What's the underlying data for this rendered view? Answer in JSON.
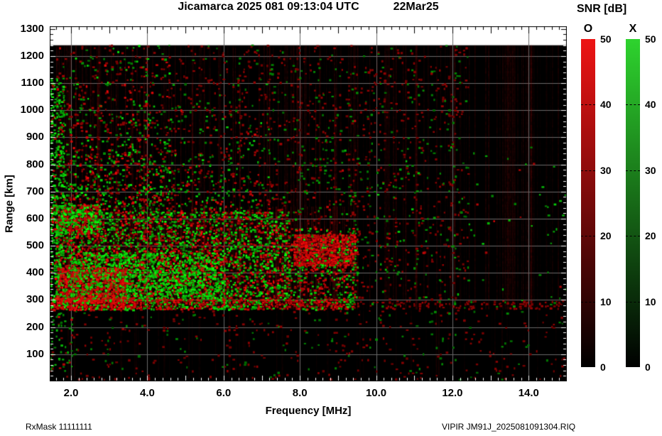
{
  "title": {
    "main": "Jicamarca 2025 081 09:13:04 UTC",
    "date": "22Mar25"
  },
  "footer": {
    "left": "RxMask 11111111",
    "right": "VIPIR  JM91J_2025081091304.RIQ"
  },
  "colorbar": {
    "title": "SNR [dB]",
    "min": 0,
    "max": 50,
    "ticks": [
      50,
      40,
      30,
      20,
      10,
      0
    ],
    "dashed_levels": [
      40,
      30,
      20,
      10
    ],
    "bars": [
      {
        "label": "O",
        "name": "o-mode",
        "color_top": "#ee1414"
      },
      {
        "label": "X",
        "name": "x-mode",
        "color_top": "#2ed32e"
      }
    ]
  },
  "chart_data": {
    "type": "heatmap",
    "title": "Jicamarca 2025 081 09:13:04 UTC 22Mar25",
    "xlabel": "Frequency [MHz]",
    "ylabel": "Range [km]",
    "xlim": [
      1.44,
      15.0
    ],
    "ylim": [
      0,
      1310
    ],
    "data_top_km": 1240,
    "grid": true,
    "grid_color": "#6a6a6a",
    "x_ticks": [
      {
        "value": 2,
        "label": "2.0"
      },
      {
        "value": 4,
        "label": "4.0"
      },
      {
        "value": 6,
        "label": "6.0"
      },
      {
        "value": 8,
        "label": "8.0"
      },
      {
        "value": 10,
        "label": "10.0"
      },
      {
        "value": 12,
        "label": "12.0"
      },
      {
        "value": 14,
        "label": "14.0"
      }
    ],
    "y_ticks": [
      {
        "value": 100,
        "label": "100"
      },
      {
        "value": 200,
        "label": "200"
      },
      {
        "value": 300,
        "label": "300"
      },
      {
        "value": 400,
        "label": "400"
      },
      {
        "value": 500,
        "label": "500"
      },
      {
        "value": 600,
        "label": "600"
      },
      {
        "value": 700,
        "label": "700"
      },
      {
        "value": 800,
        "label": "800"
      },
      {
        "value": 900,
        "label": "900"
      },
      {
        "value": 1000,
        "label": "1000"
      },
      {
        "value": 1100,
        "label": "1100"
      },
      {
        "value": 1200,
        "label": "1200"
      },
      {
        "value": 1300,
        "label": "1300"
      }
    ],
    "minor_tick_step_mhz": 0.2,
    "major_tick_step_mhz": 1.0,
    "minor_tick_step_km": 20,
    "major_tick_step_km": 100,
    "colorbars": [
      {
        "label": "O",
        "meaning": "O-mode SNR [dB]",
        "range": [
          0,
          50
        ]
      },
      {
        "label": "X",
        "meaning": "X-mode SNR [dB]",
        "range": [
          0,
          50
        ]
      }
    ],
    "seed": 1337,
    "echo_regions": [
      {
        "name": "below-band-noise",
        "f": [
          1.44,
          15.0
        ],
        "r": [
          5,
          262
        ],
        "density": 0.05,
        "green": 0.3,
        "bright": [
          0.05,
          0.3
        ],
        "cell": 3
      },
      {
        "name": "bottom-left-green",
        "f": [
          1.44,
          2.05
        ],
        "r": [
          40,
          262
        ],
        "density": 0.14,
        "green": 0.85,
        "bright": [
          0.15,
          0.65
        ],
        "cell": 3
      },
      {
        "name": "faint-wide-noise",
        "f": [
          1.6,
          12.4
        ],
        "r": [
          300,
          1240
        ],
        "density": 0.09,
        "green": 0.3,
        "bright": [
          0.08,
          0.35
        ],
        "cell": 3
      },
      {
        "name": "upper-spread-left",
        "f": [
          1.7,
          4.6
        ],
        "r": [
          620,
          1245
        ],
        "density": 0.34,
        "green": 0.55,
        "bright": [
          0.2,
          0.9
        ],
        "cell": 3,
        "fade_top": true
      },
      {
        "name": "upper-spread-mid",
        "f": [
          4.6,
          7.2
        ],
        "r": [
          620,
          1120
        ],
        "density": 0.16,
        "green": 0.5,
        "bright": [
          0.15,
          0.8
        ],
        "cell": 3,
        "fade_top": true
      },
      {
        "name": "upper-spread-right",
        "f": [
          7.2,
          9.6
        ],
        "r": [
          600,
          980
        ],
        "density": 0.08,
        "green": 0.5,
        "bright": [
          0.12,
          0.6
        ],
        "cell": 3,
        "fade_top": true
      },
      {
        "name": "left-green-strip",
        "f": [
          1.44,
          1.8
        ],
        "r": [
          300,
          1120
        ],
        "density": 0.4,
        "green": 0.85,
        "bright": [
          0.25,
          1.0
        ],
        "cell": 3
      },
      {
        "name": "main-cloud",
        "f": [
          1.6,
          7.7
        ],
        "r": [
          300,
          625
        ],
        "density": 0.5,
        "green": 0.58,
        "bright": [
          0.25,
          1.0
        ],
        "cell": 3,
        "fill": "red",
        "fill_alpha": 0.07
      },
      {
        "name": "cloud-bright-green",
        "f": [
          1.9,
          6.0
        ],
        "r": [
          300,
          475
        ],
        "density": 0.5,
        "green": 0.82,
        "bright": [
          0.45,
          1.0
        ],
        "cell": 3
      },
      {
        "name": "cloud-red-lowleft",
        "f": [
          1.65,
          3.45
        ],
        "r": [
          288,
          420
        ],
        "density": 0.55,
        "green": 0.22,
        "bright": [
          0.45,
          1.0
        ],
        "cell": 3,
        "fill": "red",
        "fill_alpha": 0.15
      },
      {
        "name": "blob-600-left",
        "f": [
          1.44,
          2.75
        ],
        "r": [
          548,
          652
        ],
        "density": 0.8,
        "green": 0.6,
        "bright": [
          0.35,
          1.0
        ],
        "cell": 3
      },
      {
        "name": "mid-cloud-right",
        "f": [
          7.7,
          9.5
        ],
        "r": [
          300,
          565
        ],
        "density": 0.3,
        "green": 0.45,
        "bright": [
          0.2,
          0.9
        ],
        "cell": 3
      },
      {
        "name": "f-cusp-red",
        "f": [
          7.85,
          9.45
        ],
        "r": [
          428,
          542
        ],
        "density": 0.8,
        "green": 0.13,
        "bright": [
          0.45,
          1.0
        ],
        "cell": 3,
        "fill": "red",
        "fill_alpha": 0.22
      },
      {
        "name": "e-band-main",
        "f": [
          1.44,
          3.65
        ],
        "r": [
          263,
          308
        ],
        "density": 0.95,
        "green": 0.3,
        "bright": [
          0.55,
          1.0
        ],
        "cell": 3,
        "fill": "red",
        "fill_alpha": 0.3
      },
      {
        "name": "e-band-mid",
        "f": [
          3.65,
          9.4
        ],
        "r": [
          266,
          302
        ],
        "density": 0.78,
        "green": 0.34,
        "bright": [
          0.3,
          0.9
        ],
        "cell": 3,
        "fill": "red",
        "fill_alpha": 0.12
      },
      {
        "name": "e-band-faint",
        "f": [
          9.4,
          15.0
        ],
        "r": [
          266,
          296
        ],
        "density": 0.3,
        "green": 0.08,
        "bright": [
          0.1,
          0.4
        ],
        "cell": 3
      },
      {
        "name": "sparse-right-dots",
        "f": [
          9.5,
          15.0
        ],
        "r": [
          280,
          920
        ],
        "density": 0.02,
        "green": 0.75,
        "bright": [
          0.2,
          0.7
        ],
        "cell": 4
      }
    ],
    "rfi_streaks": [
      {
        "name": "full-height-faint",
        "count": 220,
        "f": [
          1.5,
          15.0
        ],
        "r": [
          270,
          1240
        ],
        "alpha": [
          0.04,
          0.22
        ],
        "width": [
          1,
          2
        ]
      },
      {
        "name": "cloud-red-columns",
        "count": 90,
        "f": [
          1.6,
          9.4
        ],
        "r": [
          288,
          645
        ],
        "alpha": [
          0.1,
          0.38
        ],
        "width": [
          1,
          2.5
        ]
      },
      {
        "name": "below-band-faint",
        "count": 60,
        "f": [
          1.5,
          14.8
        ],
        "r": [
          20,
          262
        ],
        "alpha": [
          0.03,
          0.12
        ],
        "width": [
          1,
          2
        ]
      },
      {
        "name": "strong-sporadic",
        "count": 16,
        "f": [
          1.8,
          9.2
        ],
        "r": [
          270,
          1100
        ],
        "alpha": [
          0.18,
          0.4
        ],
        "width": [
          1,
          2
        ]
      }
    ]
  }
}
